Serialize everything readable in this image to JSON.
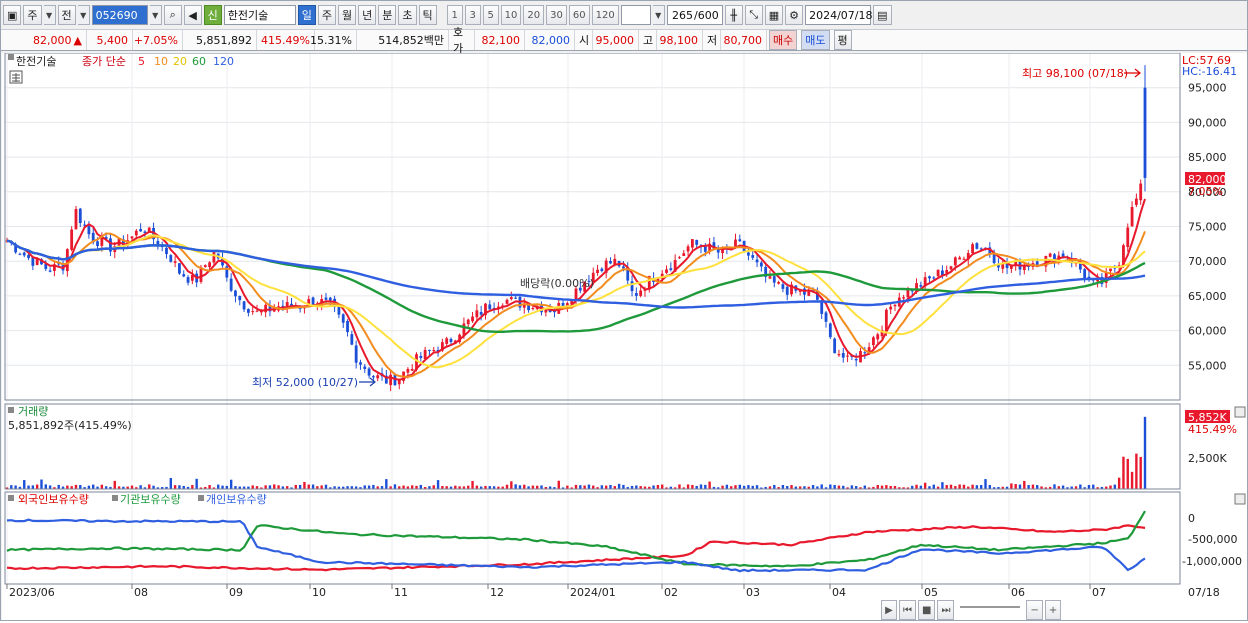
{
  "toolbar": {
    "market": "주",
    "market2": "전",
    "code": "052690",
    "stock_tag": "신",
    "stock_name": "한전기술",
    "periods": [
      "일",
      "주",
      "월",
      "년",
      "분",
      "초",
      "틱"
    ],
    "active_period": "일",
    "minutes": [
      "1",
      "3",
      "5",
      "10",
      "20",
      "30",
      "60",
      "120"
    ],
    "count": "265",
    "count_max": "/600",
    "date": "2024/07/18"
  },
  "quote": {
    "price": "82,000",
    "change_arrow": "▲",
    "change": "5,400",
    "change_pct": "+7.05%",
    "volume": "5,851,892",
    "volume_ratio": "415.49%",
    "turnover": "15.31%",
    "amount": "514,852백만",
    "bid_label": "호가",
    "bid1": "82,100",
    "bid2": "82,000",
    "open_label": "시",
    "open": "95,000",
    "high_label": "고",
    "high": "98,100",
    "low_label": "저",
    "low": "80,700",
    "buy_label": "매수",
    "sell_label": "매도",
    "eval_label": "평"
  },
  "price_panel": {
    "legend_name": "한전기술",
    "legend_type": "종가 단순",
    "ma_labels": [
      "5",
      "10",
      "20",
      "60",
      "120"
    ],
    "lc_label": "LC:57.69",
    "hc_label": "HC:-16.41",
    "high_note": "최고 98,100 (07/18)",
    "low_note": "최저 52,000 (10/27)",
    "dividend_note": "배당락(0.00%)",
    "current_price_tag": "82,000",
    "current_pct_tag": "7.05%",
    "y_ticks": [
      "95,000",
      "90,000",
      "85,000",
      "80,000",
      "75,000",
      "70,000",
      "65,000",
      "60,000",
      "55,000"
    ]
  },
  "volume_panel": {
    "title": "거래량",
    "value": "5,851,892주(415.49%)",
    "tag": "5,852K",
    "tag_pct": "415.49%",
    "y_tick": "2,500K"
  },
  "holding_panel": {
    "legend": [
      "외국인보유수량",
      "기관보유수량",
      "개인보유수량"
    ],
    "y_ticks": [
      "0",
      "-500,000",
      "-1,000,000"
    ]
  },
  "x_axis": {
    "labels": [
      "2023/06",
      "08",
      "09",
      "10",
      "11",
      "12",
      "2024/01",
      "02",
      "03",
      "04",
      "05",
      "06",
      "07"
    ],
    "right_label": "07/18"
  },
  "colors": {
    "ma5": "#e8192c",
    "ma10": "#f28c1e",
    "ma20": "#ffe13d",
    "ma60": "#1e9a3b",
    "ma120": "#2f5fe0",
    "up": "#e8192c",
    "down": "#1b4fd8"
  },
  "icons": [
    "menu-icon",
    "search-icon",
    "speaker-icon",
    "candle-icon",
    "crosshair-icon",
    "grid-icon",
    "gear-icon",
    "calendar-icon"
  ]
}
